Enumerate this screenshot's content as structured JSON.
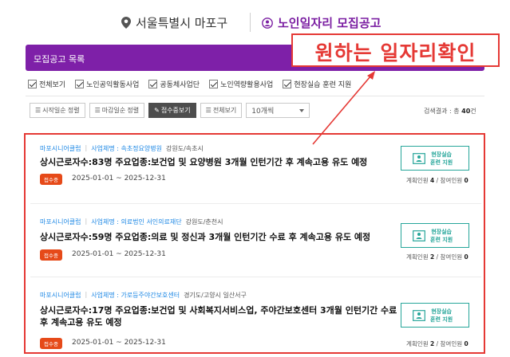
{
  "header": {
    "location": "서울특별시 마포구",
    "title": "노인일자리 모집공고"
  },
  "annotation": {
    "text": "원하는 일자리확인",
    "color": "#e53935"
  },
  "banner": {
    "title": "모집공고 목록",
    "color": "#7e20a8"
  },
  "filters": [
    {
      "label": "전체보기",
      "checked": true
    },
    {
      "label": "노인공익활동사업",
      "checked": true
    },
    {
      "label": "공동체사업단",
      "checked": true
    },
    {
      "label": "노인역량활용사업",
      "checked": true
    },
    {
      "label": "현장실습 훈련 지원",
      "checked": true
    }
  ],
  "toolbar": {
    "btn_before": "시작일순 정렬",
    "btn_deadline": "마감일순 정렬",
    "btn_receiving": "접수중보기",
    "btn_all": "전체보기",
    "page_size": "10개씩"
  },
  "result": {
    "label": "검색결과 : 총",
    "count": "40",
    "unit": "건"
  },
  "cards": [
    {
      "agency": "마포시니어클럽",
      "type": "사업체명 : 속초정요양병원",
      "region": "강원도/속초시",
      "title": "상시근로자수:83명 주요업종:보건업 및 요양병원 3개월 인턴기간 후 계속고용 유도 예정",
      "badge": "접수중",
      "period": "2025-01-01 ~ 2025-12-31",
      "support_line1": "현장실습",
      "support_line2": "훈련 지원",
      "plan_label": "계획인원",
      "plan": "4",
      "join_label": "참여인원",
      "join": "0"
    },
    {
      "agency": "마포시니어클럽",
      "type": "사업체명 : 의료법인 서인의료재단",
      "region": "강원도/춘천시",
      "title": "상시근로자수:59명 주요업종:의료 및 정신과 3개월 인턴기간 수료 후 계속고용 유도 예정",
      "badge": "접수중",
      "period": "2025-01-01 ~ 2025-12-31",
      "support_line1": "현장실습",
      "support_line2": "훈련 지원",
      "plan_label": "계획인원",
      "plan": "2",
      "join_label": "참여인원",
      "join": "0"
    },
    {
      "agency": "마포시니어클럽",
      "type": "사업체명 : 가로등주야간보호센터",
      "region": "경기도/고양시 일산서구",
      "title": "상시근로자수:17명 주요업종:보건업 및 사회복지서비스업, 주야간보호센터 3개월 인턴기간 수료 후 계속고용 유도 예정",
      "badge": "접수중",
      "period": "2025-01-01 ~ 2025-12-31",
      "support_line1": "현장실습",
      "support_line2": "훈련 지원",
      "plan_label": "계획인원",
      "plan": "2",
      "join_label": "참여인원",
      "join": "0"
    }
  ]
}
